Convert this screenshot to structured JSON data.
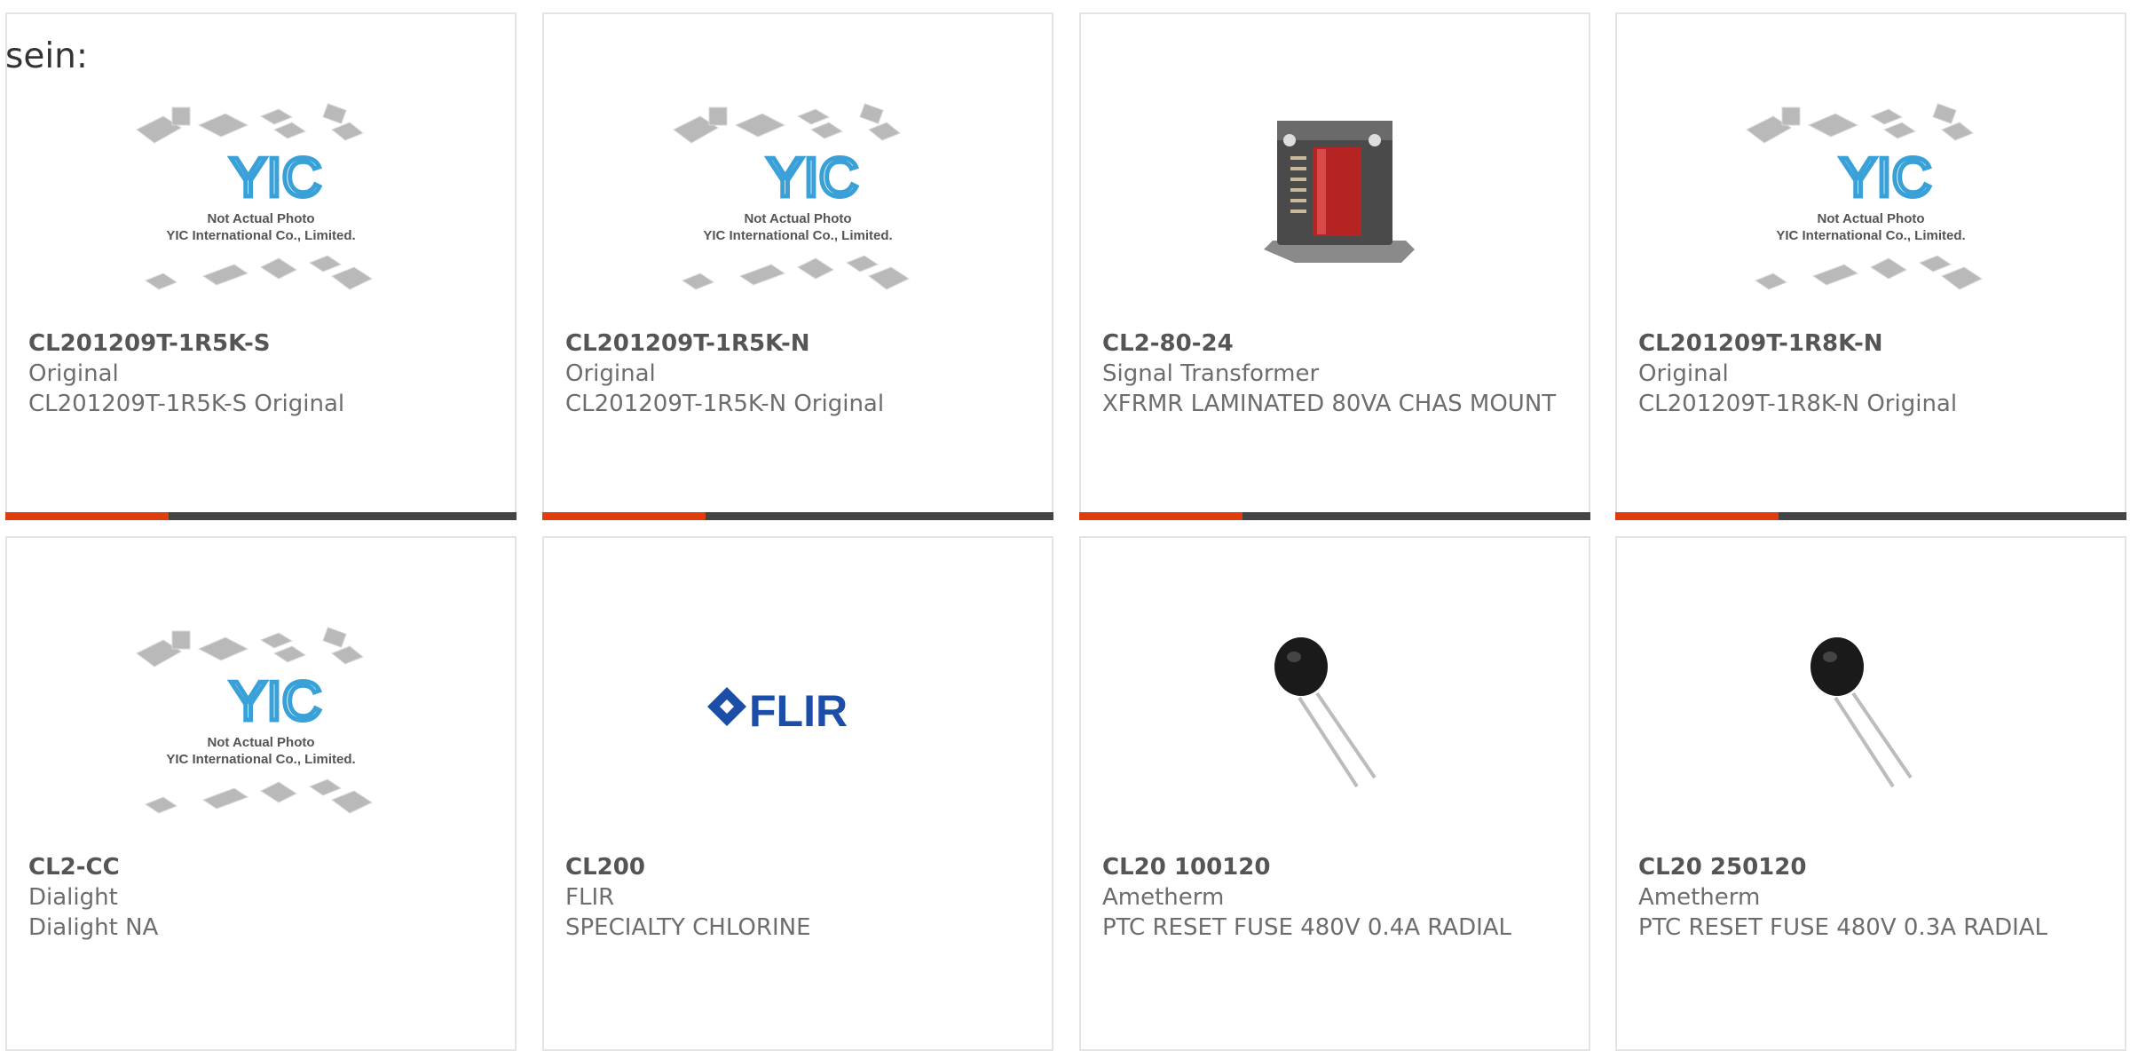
{
  "top_fragment": "sein:",
  "colors": {
    "accent": "#e03c0c",
    "bar": "#444444",
    "card_border": "#e4e4e4",
    "yic_blue": "#3aa0d8",
    "flir_blue": "#1c4ea8"
  },
  "products": [
    {
      "part": "CL201209T-1R5K-S",
      "maker": "Original",
      "desc": "CL201209T-1R5K-S Original",
      "image": "yic-placeholder-icon",
      "yic_caption": [
        "Not Actual Photo",
        "YIC International Co., Limited."
      ]
    },
    {
      "part": "CL201209T-1R5K-N",
      "maker": "Original",
      "desc": "CL201209T-1R5K-N Original",
      "image": "yic-placeholder-icon",
      "yic_caption": [
        "Not Actual Photo",
        "YIC International Co., Limited."
      ]
    },
    {
      "part": "CL2-80-24",
      "maker": "Signal Transformer",
      "desc": "XFRMR LAMINATED 80VA CHAS MOUNT",
      "image": "transformer-icon"
    },
    {
      "part": "CL201209T-1R8K-N",
      "maker": "Original",
      "desc": "CL201209T-1R8K-N Original",
      "image": "yic-placeholder-icon",
      "yic_caption": [
        "Not Actual Photo",
        "YIC International Co., Limited."
      ]
    },
    {
      "part": "CL2-CC",
      "maker": "Dialight",
      "desc": "Dialight NA",
      "image": "yic-placeholder-icon",
      "yic_caption": [
        "Not Actual Photo",
        "YIC International Co., Limited."
      ]
    },
    {
      "part": "CL200",
      "maker": "FLIR",
      "desc": "SPECIALTY CHLORINE",
      "image": "flir-logo",
      "logo_text": "FLIR"
    },
    {
      "part": "CL20 100120",
      "maker": "Ametherm",
      "desc": "PTC RESET FUSE 480V 0.4A RADIAL",
      "image": "thermistor-icon"
    },
    {
      "part": "CL20 250120",
      "maker": "Ametherm",
      "desc": "PTC RESET FUSE 480V 0.3A RADIAL",
      "image": "thermistor-icon"
    }
  ]
}
